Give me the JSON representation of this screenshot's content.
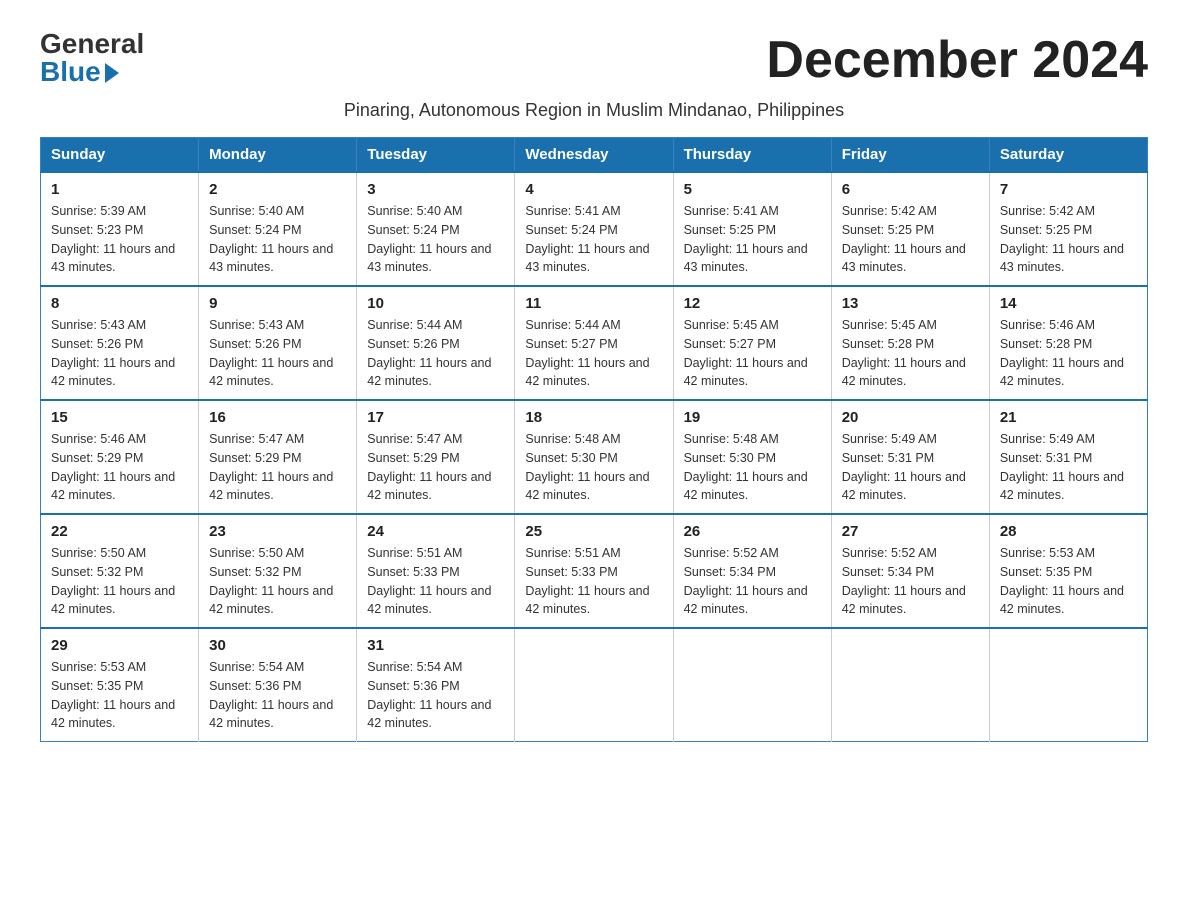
{
  "logo": {
    "general": "General",
    "blue": "Blue"
  },
  "header": {
    "month_title": "December 2024",
    "subtitle": "Pinaring, Autonomous Region in Muslim Mindanao, Philippines"
  },
  "weekdays": [
    "Sunday",
    "Monday",
    "Tuesday",
    "Wednesday",
    "Thursday",
    "Friday",
    "Saturday"
  ],
  "weeks": [
    [
      {
        "day": "1",
        "sunrise": "Sunrise: 5:39 AM",
        "sunset": "Sunset: 5:23 PM",
        "daylight": "Daylight: 11 hours and 43 minutes."
      },
      {
        "day": "2",
        "sunrise": "Sunrise: 5:40 AM",
        "sunset": "Sunset: 5:24 PM",
        "daylight": "Daylight: 11 hours and 43 minutes."
      },
      {
        "day": "3",
        "sunrise": "Sunrise: 5:40 AM",
        "sunset": "Sunset: 5:24 PM",
        "daylight": "Daylight: 11 hours and 43 minutes."
      },
      {
        "day": "4",
        "sunrise": "Sunrise: 5:41 AM",
        "sunset": "Sunset: 5:24 PM",
        "daylight": "Daylight: 11 hours and 43 minutes."
      },
      {
        "day": "5",
        "sunrise": "Sunrise: 5:41 AM",
        "sunset": "Sunset: 5:25 PM",
        "daylight": "Daylight: 11 hours and 43 minutes."
      },
      {
        "day": "6",
        "sunrise": "Sunrise: 5:42 AM",
        "sunset": "Sunset: 5:25 PM",
        "daylight": "Daylight: 11 hours and 43 minutes."
      },
      {
        "day": "7",
        "sunrise": "Sunrise: 5:42 AM",
        "sunset": "Sunset: 5:25 PM",
        "daylight": "Daylight: 11 hours and 43 minutes."
      }
    ],
    [
      {
        "day": "8",
        "sunrise": "Sunrise: 5:43 AM",
        "sunset": "Sunset: 5:26 PM",
        "daylight": "Daylight: 11 hours and 42 minutes."
      },
      {
        "day": "9",
        "sunrise": "Sunrise: 5:43 AM",
        "sunset": "Sunset: 5:26 PM",
        "daylight": "Daylight: 11 hours and 42 minutes."
      },
      {
        "day": "10",
        "sunrise": "Sunrise: 5:44 AM",
        "sunset": "Sunset: 5:26 PM",
        "daylight": "Daylight: 11 hours and 42 minutes."
      },
      {
        "day": "11",
        "sunrise": "Sunrise: 5:44 AM",
        "sunset": "Sunset: 5:27 PM",
        "daylight": "Daylight: 11 hours and 42 minutes."
      },
      {
        "day": "12",
        "sunrise": "Sunrise: 5:45 AM",
        "sunset": "Sunset: 5:27 PM",
        "daylight": "Daylight: 11 hours and 42 minutes."
      },
      {
        "day": "13",
        "sunrise": "Sunrise: 5:45 AM",
        "sunset": "Sunset: 5:28 PM",
        "daylight": "Daylight: 11 hours and 42 minutes."
      },
      {
        "day": "14",
        "sunrise": "Sunrise: 5:46 AM",
        "sunset": "Sunset: 5:28 PM",
        "daylight": "Daylight: 11 hours and 42 minutes."
      }
    ],
    [
      {
        "day": "15",
        "sunrise": "Sunrise: 5:46 AM",
        "sunset": "Sunset: 5:29 PM",
        "daylight": "Daylight: 11 hours and 42 minutes."
      },
      {
        "day": "16",
        "sunrise": "Sunrise: 5:47 AM",
        "sunset": "Sunset: 5:29 PM",
        "daylight": "Daylight: 11 hours and 42 minutes."
      },
      {
        "day": "17",
        "sunrise": "Sunrise: 5:47 AM",
        "sunset": "Sunset: 5:29 PM",
        "daylight": "Daylight: 11 hours and 42 minutes."
      },
      {
        "day": "18",
        "sunrise": "Sunrise: 5:48 AM",
        "sunset": "Sunset: 5:30 PM",
        "daylight": "Daylight: 11 hours and 42 minutes."
      },
      {
        "day": "19",
        "sunrise": "Sunrise: 5:48 AM",
        "sunset": "Sunset: 5:30 PM",
        "daylight": "Daylight: 11 hours and 42 minutes."
      },
      {
        "day": "20",
        "sunrise": "Sunrise: 5:49 AM",
        "sunset": "Sunset: 5:31 PM",
        "daylight": "Daylight: 11 hours and 42 minutes."
      },
      {
        "day": "21",
        "sunrise": "Sunrise: 5:49 AM",
        "sunset": "Sunset: 5:31 PM",
        "daylight": "Daylight: 11 hours and 42 minutes."
      }
    ],
    [
      {
        "day": "22",
        "sunrise": "Sunrise: 5:50 AM",
        "sunset": "Sunset: 5:32 PM",
        "daylight": "Daylight: 11 hours and 42 minutes."
      },
      {
        "day": "23",
        "sunrise": "Sunrise: 5:50 AM",
        "sunset": "Sunset: 5:32 PM",
        "daylight": "Daylight: 11 hours and 42 minutes."
      },
      {
        "day": "24",
        "sunrise": "Sunrise: 5:51 AM",
        "sunset": "Sunset: 5:33 PM",
        "daylight": "Daylight: 11 hours and 42 minutes."
      },
      {
        "day": "25",
        "sunrise": "Sunrise: 5:51 AM",
        "sunset": "Sunset: 5:33 PM",
        "daylight": "Daylight: 11 hours and 42 minutes."
      },
      {
        "day": "26",
        "sunrise": "Sunrise: 5:52 AM",
        "sunset": "Sunset: 5:34 PM",
        "daylight": "Daylight: 11 hours and 42 minutes."
      },
      {
        "day": "27",
        "sunrise": "Sunrise: 5:52 AM",
        "sunset": "Sunset: 5:34 PM",
        "daylight": "Daylight: 11 hours and 42 minutes."
      },
      {
        "day": "28",
        "sunrise": "Sunrise: 5:53 AM",
        "sunset": "Sunset: 5:35 PM",
        "daylight": "Daylight: 11 hours and 42 minutes."
      }
    ],
    [
      {
        "day": "29",
        "sunrise": "Sunrise: 5:53 AM",
        "sunset": "Sunset: 5:35 PM",
        "daylight": "Daylight: 11 hours and 42 minutes."
      },
      {
        "day": "30",
        "sunrise": "Sunrise: 5:54 AM",
        "sunset": "Sunset: 5:36 PM",
        "daylight": "Daylight: 11 hours and 42 minutes."
      },
      {
        "day": "31",
        "sunrise": "Sunrise: 5:54 AM",
        "sunset": "Sunset: 5:36 PM",
        "daylight": "Daylight: 11 hours and 42 minutes."
      },
      null,
      null,
      null,
      null
    ]
  ]
}
